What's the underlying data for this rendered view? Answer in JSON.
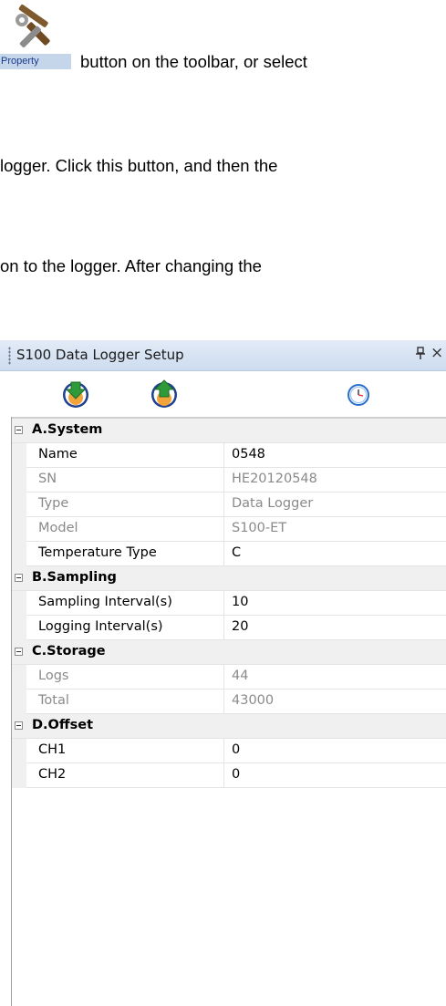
{
  "document": {
    "line1": "button on the toolbar, or select",
    "line2": "logger. Click this button, and then the",
    "line3": "on  to  the  logger.  After  changing  the"
  },
  "property_button": {
    "label": "Property",
    "icon": "tools-icon"
  },
  "panel": {
    "title": "S100 Data Logger Setup",
    "pin_icon": "pin-icon",
    "close_glyph": "×",
    "toolbar": [
      {
        "icon": "download-arrow-icon",
        "color": "#2e9a3a"
      },
      {
        "icon": "upload-arrow-icon",
        "color": "#2e9a3a"
      },
      {
        "icon": "clock-icon",
        "color": "#2a6fc9"
      }
    ],
    "categories": [
      {
        "label": "A.System",
        "rows": [
          {
            "name": "Name",
            "value": "0548",
            "readonly": false
          },
          {
            "name": "SN",
            "value": "HE20120548",
            "readonly": true
          },
          {
            "name": "Type",
            "value": "Data Logger",
            "readonly": true
          },
          {
            "name": "Model",
            "value": "S100-ET",
            "readonly": true
          },
          {
            "name": "Temperature Type",
            "value": "C",
            "readonly": false
          }
        ]
      },
      {
        "label": "B.Sampling",
        "rows": [
          {
            "name": "Sampling Interval(s)",
            "value": "10",
            "readonly": false
          },
          {
            "name": "Logging Interval(s)",
            "value": "20",
            "readonly": false
          }
        ]
      },
      {
        "label": "C.Storage",
        "rows": [
          {
            "name": "Logs",
            "value": "44",
            "readonly": true
          },
          {
            "name": "Total",
            "value": "43000",
            "readonly": true
          }
        ]
      },
      {
        "label": "D.Offset",
        "rows": [
          {
            "name": "CH1",
            "value": "0",
            "readonly": false
          },
          {
            "name": "CH2",
            "value": "0",
            "readonly": false
          }
        ]
      }
    ]
  }
}
